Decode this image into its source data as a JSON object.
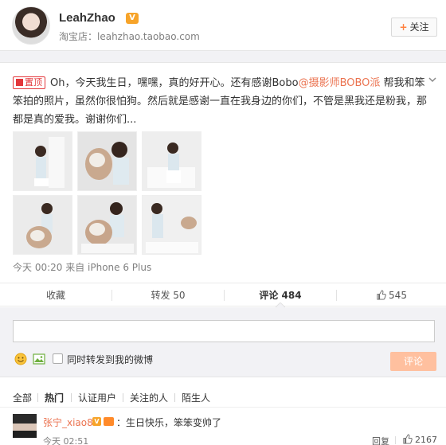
{
  "profile": {
    "name": "LeahZhao",
    "badge": "V",
    "shop_label": "淘宝店：leahzhao.taobao.com",
    "follow_label": "关注",
    "follow_plus": "+"
  },
  "post": {
    "pin_label": "置顶",
    "text_before": "Oh，今天我生日，嘿嘿，真的好开心。还有感谢Bobo",
    "mention": "@摄影师BOBO派",
    "text_after": " 帮我和笨笨拍的照片，虽然你很怕狗。然后就是感谢一直在我身边的你们，不管是黑我还是粉我，那都是真的爱我。谢谢你们...",
    "meta": "今天 00:20 来自 iPhone 6 Plus",
    "photo_count": 6
  },
  "actions": {
    "favorite": "收藏",
    "repost": "转发 50",
    "comment": "评论 484",
    "like": "545"
  },
  "composer": {
    "placeholder": "",
    "repost_option": "同时转发到我的微博",
    "submit": "评论"
  },
  "filters": [
    "全部",
    "热门",
    "认证用户",
    "关注的人",
    "陌生人"
  ],
  "comment": {
    "user": "张宁_xiao8",
    "text": "：生日快乐，笨笨变帅了",
    "time": "今天 02:51",
    "reply": "回复",
    "likes": "2167"
  },
  "colors": {
    "accent": "#eb7350",
    "pin": "#e3373b",
    "button_disabled": "#ffc09f",
    "vip": "#f7a42a"
  },
  "icons": [
    "chevron-down-icon",
    "emoji-icon",
    "image-icon",
    "thumb-up-icon",
    "pin-icon",
    "plus-icon"
  ]
}
